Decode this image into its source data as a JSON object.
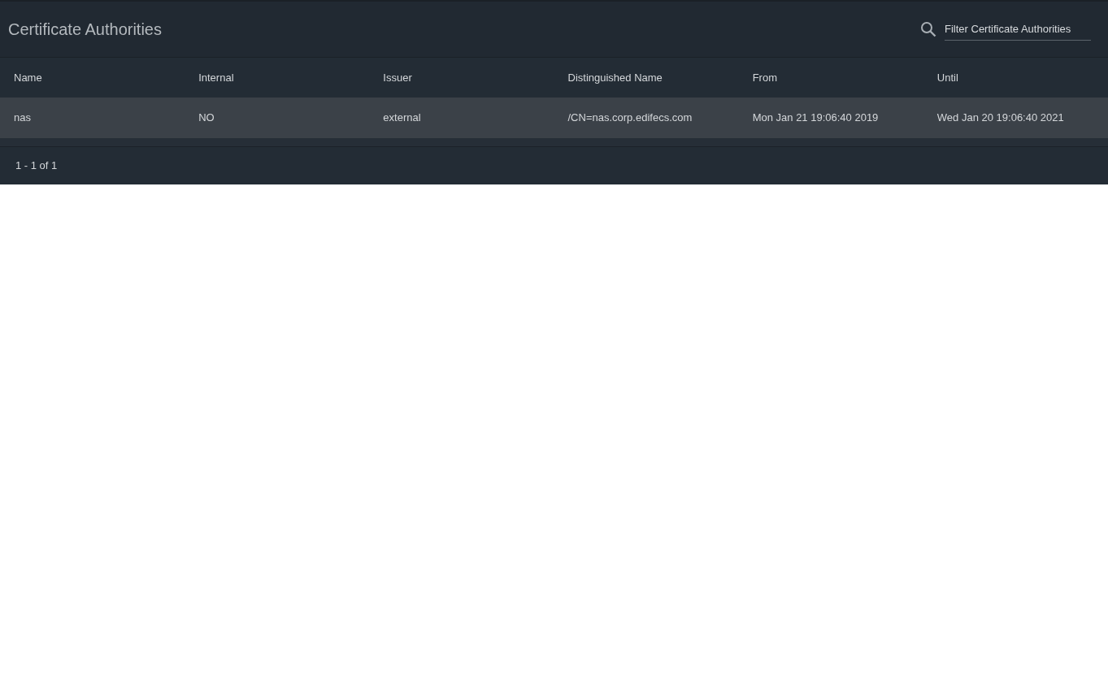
{
  "header": {
    "title": "Certificate Authorities",
    "filter": {
      "placeholder": "Filter Certificate Authorities"
    }
  },
  "table": {
    "columns": [
      "Name",
      "Internal",
      "Issuer",
      "Distinguished Name",
      "From",
      "Until"
    ],
    "rows": [
      {
        "selected": true,
        "cells": [
          "nas",
          "NO",
          "external",
          "/CN=nas.corp.edifecs.com",
          "Mon Jan 21 19:06:40 2019",
          "Wed Jan 20 19:06:40 2021"
        ]
      }
    ]
  },
  "footer": {
    "range": "1 - 1 of 1"
  }
}
